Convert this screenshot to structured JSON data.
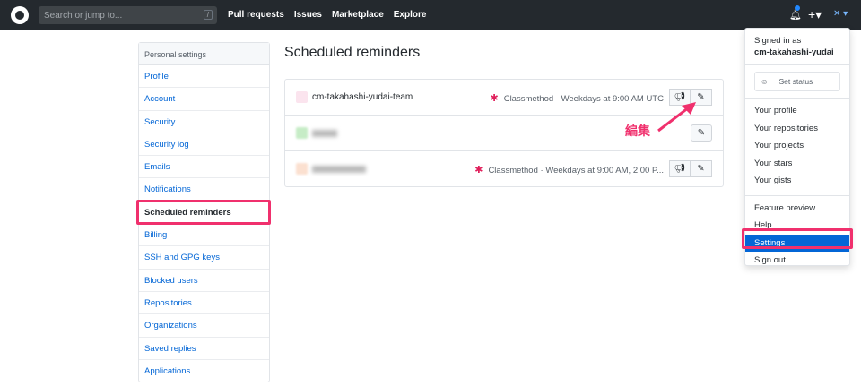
{
  "header": {
    "search_placeholder": "Search or jump to...",
    "slash": "/",
    "nav": [
      "Pull requests",
      "Issues",
      "Marketplace",
      "Explore"
    ]
  },
  "sidebar": {
    "heading": "Personal settings",
    "items": [
      "Profile",
      "Account",
      "Security",
      "Security log",
      "Emails",
      "Notifications",
      "Scheduled reminders",
      "Billing",
      "SSH and GPG keys",
      "Blocked users",
      "Repositories",
      "Organizations",
      "Saved replies",
      "Applications"
    ],
    "selected": "Scheduled reminders"
  },
  "main": {
    "title": "Scheduled reminders",
    "reminders": [
      {
        "name": "cm-takahashi-yudai-team",
        "info": "Classmethod · Weekdays at 9:00 AM UTC"
      },
      {
        "name": "",
        "info": ""
      },
      {
        "name": "",
        "info": "Classmethod · Weekdays at 9:00 AM, 2:00 P..."
      }
    ]
  },
  "annotation": {
    "label": "編集",
    "color": "#f0306d"
  },
  "dropdown": {
    "signed_in_as": "Signed in as",
    "username": "cm-takahashi-yudai",
    "set_status": "Set status",
    "group1": [
      "Your profile",
      "Your repositories",
      "Your projects",
      "Your stars",
      "Your gists"
    ],
    "group2": [
      "Feature preview",
      "Help",
      "Settings",
      "Sign out"
    ]
  }
}
